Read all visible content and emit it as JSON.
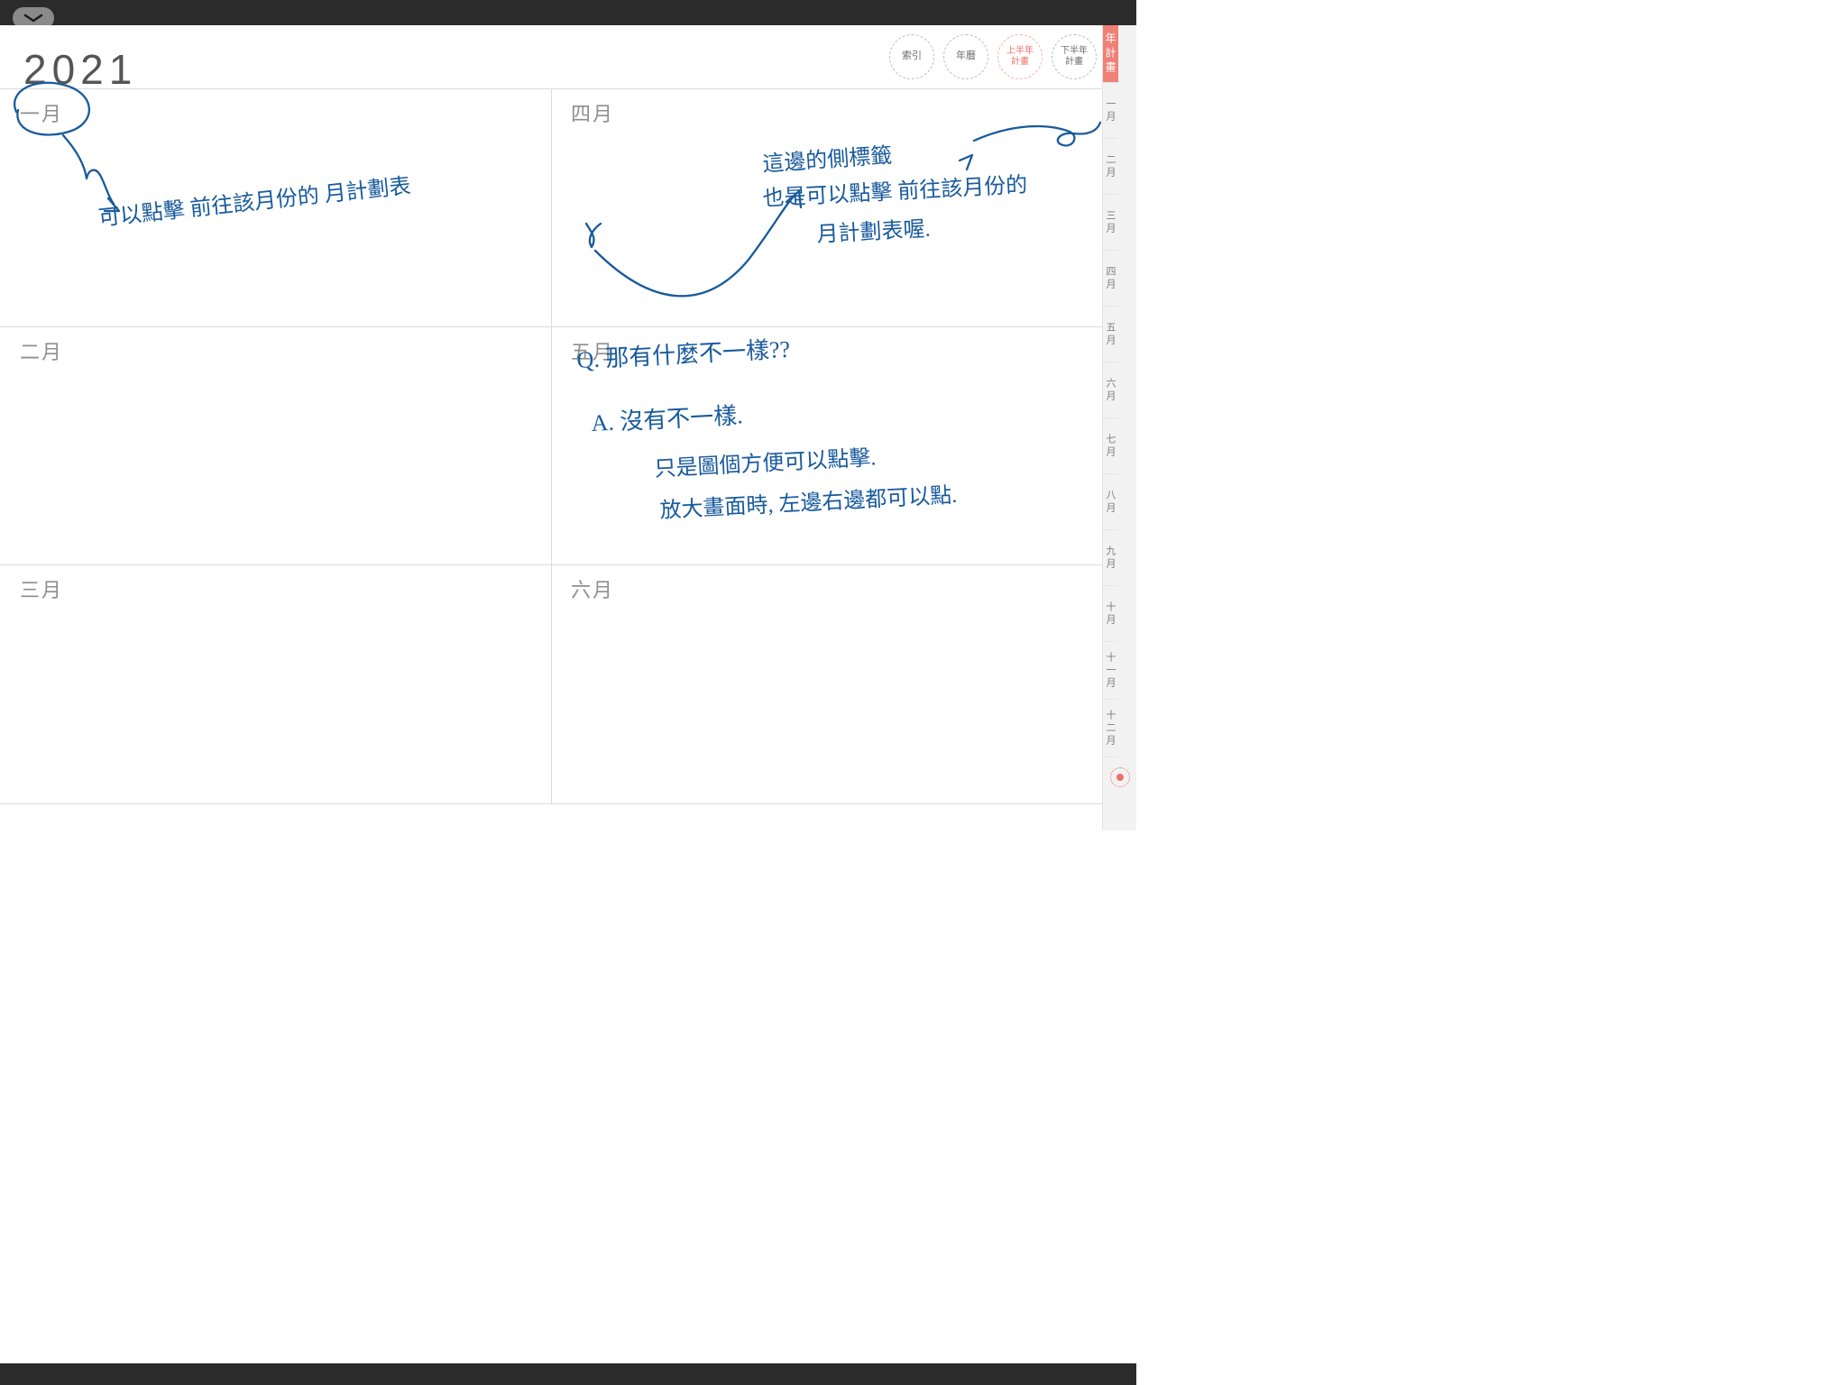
{
  "year": "2021",
  "nav": {
    "index": "索引",
    "calendar": "年曆",
    "first_half_plan": "上半年\n計畫",
    "second_half_plan": "下半年\n計畫"
  },
  "sidebar": {
    "year_plan": "年計畫",
    "months": [
      "一月",
      "二月",
      "三月",
      "四月",
      "五月",
      "六月",
      "七月",
      "八月",
      "九月",
      "十月",
      "十一月",
      "十二月"
    ]
  },
  "cells": {
    "jan": "一月",
    "feb": "二月",
    "mar": "三月",
    "apr": "四月",
    "may": "五月",
    "jun": "六月"
  },
  "handwriting": {
    "left_note": "可以點擊 前往該月份的 月計劃表",
    "right_note_l1": "這邊的側標籤",
    "right_note_l2": "也是可以點擊 前往該月份的",
    "right_note_l3": "月計劃表喔.",
    "qa_q": "Q. 那有什麼不一樣??",
    "qa_a1": "A. 沒有不一樣.",
    "qa_a2": "只是圖個方便可以點擊.",
    "qa_a3": "放大畫面時, 左邊右邊都可以點."
  }
}
